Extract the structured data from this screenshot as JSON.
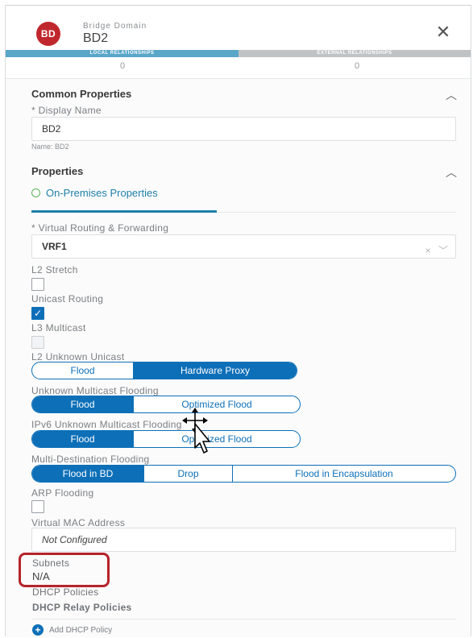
{
  "header": {
    "badge": "BD",
    "subtitle": "Bridge Domain",
    "title": "BD2",
    "close_glyph": "✕"
  },
  "tabs": [
    {
      "label": "LOCAL RELATIONSHIPS",
      "count": "0",
      "active": true
    },
    {
      "label": "EXTERNAL RELATIONSHIPS",
      "count": "0",
      "active": false
    }
  ],
  "common": {
    "title": "Common Properties",
    "display_name_label": "* Display Name",
    "display_name_value": "BD2",
    "name_hint": "Name: BD2"
  },
  "properties": {
    "title": "Properties",
    "onprem_label": "On-Premises Properties",
    "vrf_label": "* Virtual Routing & Forwarding",
    "vrf_value": "VRF1",
    "vrf_clear": "×",
    "vrf_chevron": "﹀",
    "l2_stretch_label": "L2 Stretch",
    "l2_stretch_checked": false,
    "unicast_label": "Unicast Routing",
    "unicast_checked": true,
    "l3_multicast_label": "L3 Multicast",
    "l3_multicast_checked": false,
    "l2_unknown_unicast": {
      "label": "L2 Unknown Unicast",
      "options": [
        "Flood",
        "Hardware Proxy"
      ],
      "selected": "Hardware Proxy"
    },
    "unknown_multicast": {
      "label": "Unknown Multicast Flooding",
      "options": [
        "Flood",
        "Optimized Flood"
      ],
      "selected": "Flood"
    },
    "ipv6_unknown_multicast": {
      "label": "IPv6 Unknown Multicast Flooding",
      "options": [
        "Flood",
        "Optimized Flood"
      ],
      "selected": "Flood"
    },
    "multi_dest": {
      "label": "Multi-Destination Flooding",
      "options": [
        "Flood in BD",
        "Drop",
        "Flood in Encapsulation"
      ],
      "selected": "Flood in BD"
    },
    "arp_label": "ARP Flooding",
    "arp_checked": false,
    "vmac_label": "Virtual MAC Address",
    "vmac_placeholder": "Not Configured",
    "subnets_label": "Subnets",
    "subnets_value": "N/A",
    "dhcp_policies_label": "DHCP Policies",
    "dhcp_relay_label": "DHCP Relay Policies",
    "add_dhcp_label": "Add DHCP Policy"
  },
  "colors": {
    "accent": "#0d6fb8",
    "tab_active": "#59a6c9",
    "highlight": "#b5242b",
    "badge": "#c0272d"
  },
  "icons": [
    "close-icon",
    "chevron-up-icon",
    "check-circle-icon",
    "chevron-down-icon",
    "plus-icon",
    "move-cursor-icon"
  ]
}
